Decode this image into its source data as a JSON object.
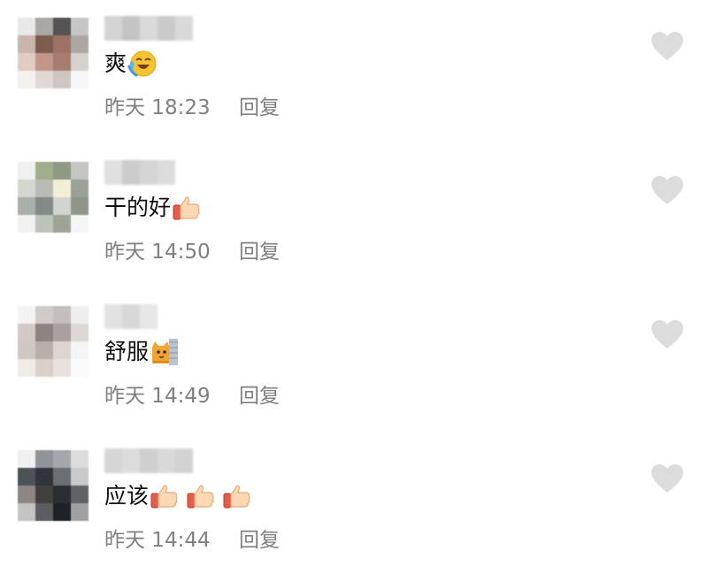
{
  "comments": [
    {
      "text": "爽",
      "emojis": [
        "laughing-tears"
      ],
      "time": "昨天 18:23",
      "reply_label": "回复",
      "avatar_colors": [
        "#e9e9e9",
        "#aaa7a4",
        "#545454",
        "#c6c6c6",
        "#c9b5a9",
        "#7e5b4f",
        "#9b7264",
        "#aaa7a4",
        "#e0cdc2",
        "#c3968a",
        "#a67c6e",
        "#d5d1cf",
        "#f4f1ef",
        "#dfd8d5",
        "#cfc6c2",
        "#f7f7f7"
      ],
      "name_colors": [
        "#d4d4d4",
        "#c4c4c4",
        "#dadada",
        "#cacaca",
        "#d9d9d9"
      ]
    },
    {
      "text": "干的好",
      "emojis": [
        "thumbs-up"
      ],
      "time": "昨天 14:50",
      "reply_label": "回复",
      "avatar_colors": [
        "#f0f0f0",
        "#a1ae8c",
        "#8e9a83",
        "#c4c6c2",
        "#d4d7d0",
        "#b9bcb5",
        "#f2eed8",
        "#9aa297",
        "#a7b0ab",
        "#818a86",
        "#d1d4cf",
        "#8e968a",
        "#f2f2f2",
        "#bcc3b8",
        "#9ea597",
        "#f6f6f6"
      ],
      "name_colors": [
        "#e0e0e0",
        "#cccccc",
        "#d5d5d5",
        "#dcdcdc"
      ]
    },
    {
      "text": "舒服",
      "emojis": [
        "cat-peek"
      ],
      "time": "昨天 14:49",
      "reply_label": "回复",
      "avatar_colors": [
        "#f3f3f3",
        "#cfcbc8",
        "#c4bfbc",
        "#eeeeee",
        "#d2c9c4",
        "#8c8480",
        "#a9a19d",
        "#dcd8d5",
        "#cec7c2",
        "#b7afaa",
        "#dcd5d0",
        "#f5f5f5",
        "#efeae6",
        "#d9d0ca",
        "#e7e2de",
        "#fbfbfb"
      ],
      "name_colors": [
        "#e2e2e2",
        "#d8d8d8",
        "#e6e6e6"
      ]
    },
    {
      "text": "应该",
      "emojis": [
        "thumbs-up",
        "thumbs-up",
        "thumbs-up"
      ],
      "time": "昨天 14:44",
      "reply_label": "回复",
      "avatar_colors": [
        "#f0f0f0",
        "#8f9496",
        "#a2a7a9",
        "#dcdcdc",
        "#4c5257",
        "#2f3539",
        "#6b6f72",
        "#c9cacb",
        "#8d8781",
        "#42403d",
        "#2b2e31",
        "#5f6366",
        "#c3c3c3",
        "#5b5d60",
        "#1f2224",
        "#9fa0a2"
      ],
      "name_colors": [
        "#d6d6d6",
        "#dcdcdc",
        "#cfcfcf",
        "#d9d9d9",
        "#d2d2d2"
      ]
    }
  ],
  "icons": {
    "like": "heart-icon",
    "laughing-tears": "laughing-tears-emoji",
    "thumbs-up": "thumbs-up-emoji",
    "cat-peek": "cat-peek-emoji"
  },
  "colors": {
    "heart": "#dcdcdc",
    "meta_text": "#808080",
    "text": "#111111"
  }
}
